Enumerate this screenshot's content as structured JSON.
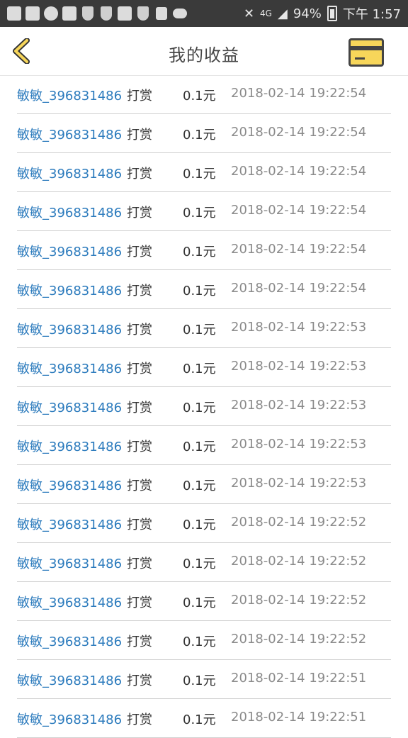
{
  "statusbar": {
    "network": "4G",
    "battery": "94%",
    "time": "下午 1:57"
  },
  "header": {
    "title": "我的收益"
  },
  "list": [
    {
      "user": "敏敏_396831486",
      "action": "打赏",
      "amount": "0.1元",
      "time": "2018-02-14 19:22:54"
    },
    {
      "user": "敏敏_396831486",
      "action": "打赏",
      "amount": "0.1元",
      "time": "2018-02-14 19:22:54"
    },
    {
      "user": "敏敏_396831486",
      "action": "打赏",
      "amount": "0.1元",
      "time": "2018-02-14 19:22:54"
    },
    {
      "user": "敏敏_396831486",
      "action": "打赏",
      "amount": "0.1元",
      "time": "2018-02-14 19:22:54"
    },
    {
      "user": "敏敏_396831486",
      "action": "打赏",
      "amount": "0.1元",
      "time": "2018-02-14 19:22:54"
    },
    {
      "user": "敏敏_396831486",
      "action": "打赏",
      "amount": "0.1元",
      "time": "2018-02-14 19:22:54"
    },
    {
      "user": "敏敏_396831486",
      "action": "打赏",
      "amount": "0.1元",
      "time": "2018-02-14 19:22:53"
    },
    {
      "user": "敏敏_396831486",
      "action": "打赏",
      "amount": "0.1元",
      "time": "2018-02-14 19:22:53"
    },
    {
      "user": "敏敏_396831486",
      "action": "打赏",
      "amount": "0.1元",
      "time": "2018-02-14 19:22:53"
    },
    {
      "user": "敏敏_396831486",
      "action": "打赏",
      "amount": "0.1元",
      "time": "2018-02-14 19:22:53"
    },
    {
      "user": "敏敏_396831486",
      "action": "打赏",
      "amount": "0.1元",
      "time": "2018-02-14 19:22:53"
    },
    {
      "user": "敏敏_396831486",
      "action": "打赏",
      "amount": "0.1元",
      "time": "2018-02-14 19:22:52"
    },
    {
      "user": "敏敏_396831486",
      "action": "打赏",
      "amount": "0.1元",
      "time": "2018-02-14 19:22:52"
    },
    {
      "user": "敏敏_396831486",
      "action": "打赏",
      "amount": "0.1元",
      "time": "2018-02-14 19:22:52"
    },
    {
      "user": "敏敏_396831486",
      "action": "打赏",
      "amount": "0.1元",
      "time": "2018-02-14 19:22:52"
    },
    {
      "user": "敏敏_396831486",
      "action": "打赏",
      "amount": "0.1元",
      "time": "2018-02-14 19:22:51"
    },
    {
      "user": "敏敏_396831486",
      "action": "打赏",
      "amount": "0.1元",
      "time": "2018-02-14 19:22:51"
    }
  ],
  "colors": {
    "accent_yellow": "#f7d65a",
    "link_blue": "#2c7bbd",
    "status_bar": "#3a3a3a"
  },
  "icons": {
    "back": "chevron-left-icon",
    "card": "card-icon"
  }
}
